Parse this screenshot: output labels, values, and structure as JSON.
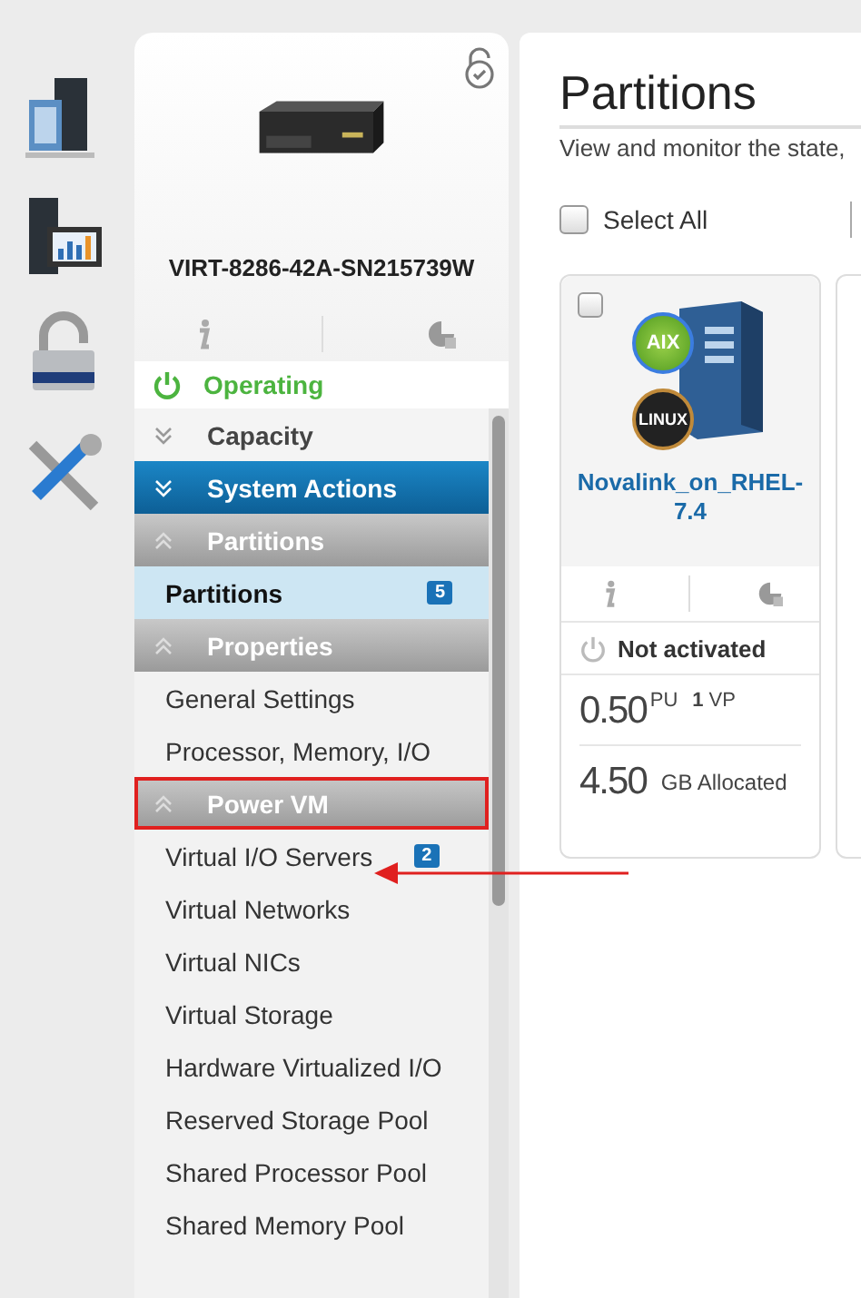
{
  "nav_icons": [
    {
      "kind": "servers"
    },
    {
      "kind": "monitor"
    },
    {
      "kind": "lock"
    },
    {
      "kind": "tools"
    }
  ],
  "system": {
    "name": "VIRT-8286-42A-SN215739W",
    "status": "Operating",
    "running": true
  },
  "sections": [
    {
      "kind": "plain",
      "title": "Capacity",
      "expanded": false,
      "highlighted": false
    },
    {
      "kind": "primary",
      "title": "System Actions",
      "expanded": false,
      "highlighted": false
    },
    {
      "kind": "group",
      "title": "Partitions",
      "expanded": true,
      "highlighted": false,
      "items": [
        {
          "label": "Partitions",
          "badge": "5",
          "selected": true,
          "pointed": false
        }
      ]
    },
    {
      "kind": "group",
      "title": "Properties",
      "expanded": true,
      "highlighted": false,
      "items": [
        {
          "label": "General Settings",
          "selected": false,
          "pointed": false
        },
        {
          "label": "Processor, Memory, I/O",
          "selected": false,
          "pointed": false
        }
      ]
    },
    {
      "kind": "group",
      "title": "Power VM",
      "expanded": true,
      "highlighted": true,
      "items": [
        {
          "label": "Virtual I/O Servers",
          "badge": "2",
          "selected": false,
          "pointed": true
        },
        {
          "label": "Virtual Networks",
          "selected": false,
          "pointed": false
        },
        {
          "label": "Virtual NICs",
          "selected": false,
          "pointed": false
        },
        {
          "label": "Virtual Storage",
          "selected": false,
          "pointed": false
        },
        {
          "label": "Hardware Virtualized I/O",
          "selected": false,
          "pointed": false
        },
        {
          "label": "Reserved Storage Pool",
          "selected": false,
          "pointed": false
        },
        {
          "label": "Shared Processor Pool",
          "selected": false,
          "pointed": false
        },
        {
          "label": "Shared Memory Pool",
          "selected": false,
          "pointed": false
        }
      ]
    }
  ],
  "main": {
    "title": "Partitions",
    "subtitle": "View and monitor the state,",
    "select_all": {
      "label": "Select All",
      "checked": false
    }
  },
  "partitions": [
    {
      "name": "Novalink_on_RHEL-7.4",
      "os_badges": [
        "AIX",
        "LINUX"
      ],
      "checked": false,
      "status": "Not activated",
      "running": false,
      "pu": "0.50",
      "pu_unit": "PU",
      "vp": "1",
      "vp_unit": "VP",
      "memory": "4.50",
      "memory_unit": "GB Allocated"
    }
  ]
}
